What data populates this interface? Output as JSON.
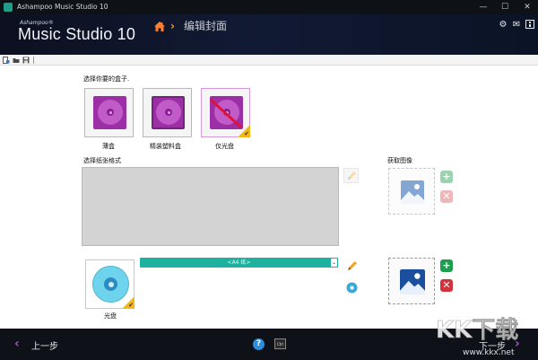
{
  "window": {
    "title": "Ashampoo Music Studio 10"
  },
  "header": {
    "brand_small": "Ashampoo®",
    "brand": "Music Studio 10",
    "breadcrumb": "编辑封面",
    "breadcrumb_separator": "›"
  },
  "main": {
    "choose_box_label": "选择你要的盒子.",
    "boxes": [
      {
        "label": "薄盒"
      },
      {
        "label": "精装塑料盒"
      },
      {
        "label": "仅光盘"
      }
    ],
    "paper_label": "选择纸张格式",
    "get_image_label": "获取图像",
    "dropdown_value": "<A4 纸>",
    "dropdown_arrow": "⌄",
    "disc_label": "光盘"
  },
  "footer": {
    "back_label": "上一步",
    "next_label": "下一步",
    "back_arrow": "‹",
    "next_arrow": "›",
    "help_label": "?",
    "ctrl_label": "Ctrl"
  },
  "watermark": {
    "text": "KK下载",
    "url": "www.kkx.net"
  },
  "colors": {
    "accent": "#1eb1a0",
    "box_purple": "#9c2ea6",
    "nav_arrow": "#9b59d0",
    "check_yellow": "#f2b81a",
    "add_green": "#1f9e50",
    "remove_red": "#d3323b"
  }
}
